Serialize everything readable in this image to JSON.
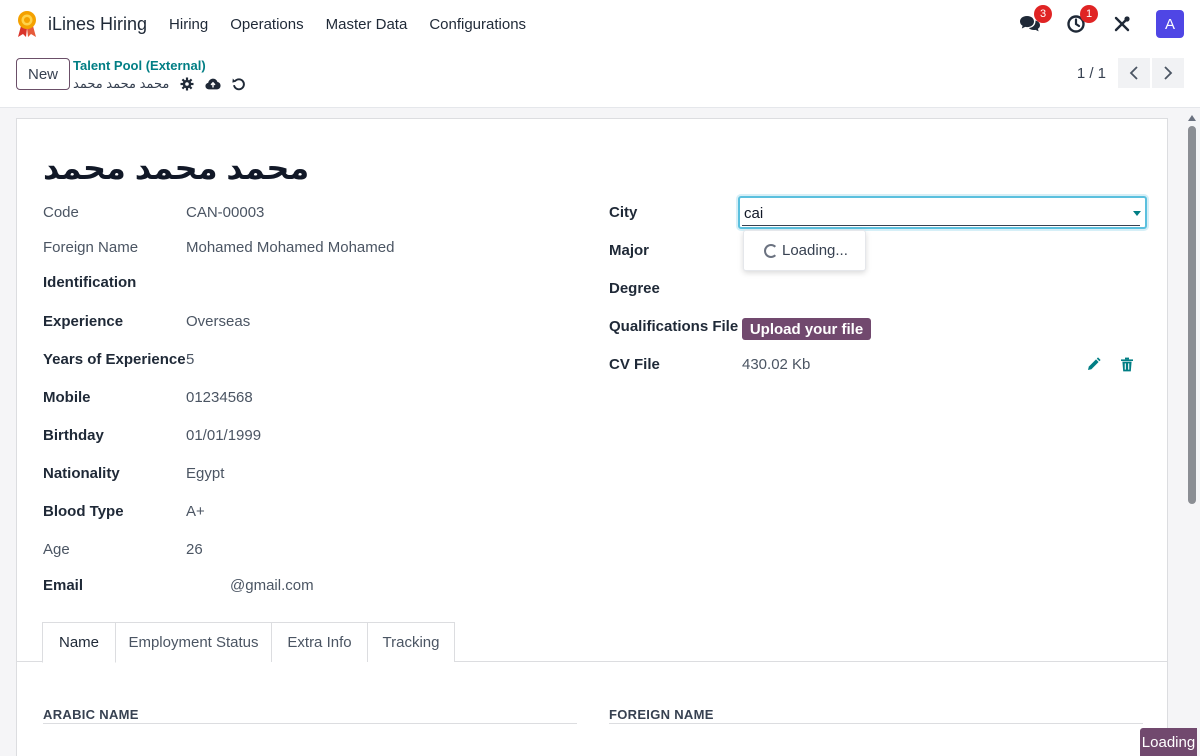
{
  "navbar": {
    "app_name": "iLines Hiring",
    "menus": [
      "Hiring",
      "Operations",
      "Master Data",
      "Configurations"
    ],
    "messages_count": "3",
    "activities_count": "1",
    "avatar_initial": "A"
  },
  "control_panel": {
    "new_label": "New",
    "breadcrumb_parent": "Talent Pool (External)",
    "breadcrumb_current": "محمد محمد محمد",
    "pager": "1 / 1"
  },
  "form": {
    "title": "محمد محمد محمد",
    "left_fields": [
      {
        "label": "Code",
        "value": "CAN-00003"
      },
      {
        "label": "Foreign Name",
        "value": "Mohamed Mohamed Mohamed"
      },
      {
        "label": "Identification",
        "value": ""
      },
      {
        "label": "Experience",
        "value": "Overseas"
      },
      {
        "label": "Years of Experience",
        "value": "5"
      },
      {
        "label": "Mobile",
        "value": "01234568"
      },
      {
        "label": "Birthday",
        "value": "01/01/1999"
      },
      {
        "label": "Nationality",
        "value": "Egypt"
      },
      {
        "label": "Blood Type",
        "value": "A+"
      },
      {
        "label": "Age",
        "value": "26"
      },
      {
        "label": "Email",
        "value": "@gmail.com"
      }
    ],
    "right_fields": {
      "city_label": "City",
      "city_value": "cai",
      "autocomplete_loading": "Loading...",
      "major_label": "Major",
      "degree_label": "Degree",
      "qualifications_label": "Qualifications File",
      "upload_label": "Upload your file",
      "cv_label": "CV File",
      "cv_size": "430.02 Kb"
    },
    "tabs": [
      "Name",
      "Employment Status",
      "Extra Info",
      "Tracking"
    ],
    "sections": {
      "arabic_name": "ARABIC NAME",
      "foreign_name": "FOREIGN NAME"
    }
  },
  "status": {
    "loading": "Loading"
  },
  "colors": {
    "brand": "#71496e",
    "link": "#017e84",
    "focus": "#5bc0de",
    "badge": "#e02424",
    "avatar": "#4f46e5"
  }
}
